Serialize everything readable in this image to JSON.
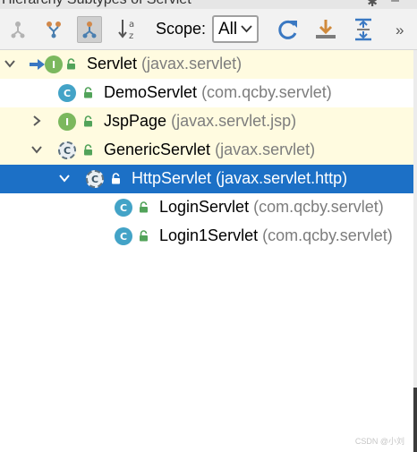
{
  "panel": {
    "title": "Hierarchy Subtypes of Servlet"
  },
  "toolbar": {
    "scope_label": "Scope:",
    "scope_value": "All",
    "more": "»",
    "buttons": [
      "subtypes-hierarchy",
      "supertypes-hierarchy",
      "class-hierarchy",
      "sort-alphabetically",
      "refresh",
      "export",
      "expand-all"
    ]
  },
  "tree": {
    "rows": [
      {
        "name": "Servlet",
        "pkg": "(javax.servlet)"
      },
      {
        "name": "DemoServlet",
        "pkg": "(com.qcby.servlet)"
      },
      {
        "name": "JspPage",
        "pkg": "(javax.servlet.jsp)"
      },
      {
        "name": "GenericServlet",
        "pkg": "(javax.servlet)"
      },
      {
        "name": "HttpServlet",
        "pkg": "(javax.servlet.http)"
      },
      {
        "name": "LoginServlet",
        "pkg": "(com.qcby.servlet)"
      },
      {
        "name": "Login1Servlet",
        "pkg": "(com.qcby.servlet)"
      }
    ],
    "icon_letters": {
      "class": "C",
      "interface": "I"
    }
  },
  "watermark": "CSDN @小刘",
  "colors": {
    "selection": "#1c70c6",
    "highlight": "#fffbe0",
    "class_icon": "#43a3c7",
    "interface_icon": "#7bb85e",
    "package_text": "#7d7d7d"
  }
}
